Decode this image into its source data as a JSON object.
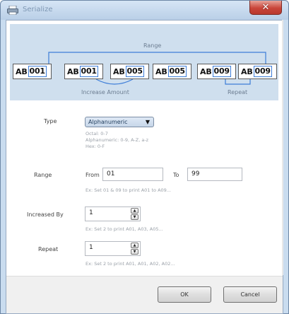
{
  "window": {
    "title": "Serialize",
    "close_icon": "close-icon"
  },
  "illustration": {
    "range_label": "Range",
    "increase_label": "Increase Amount",
    "repeat_label": "Repeat",
    "chips": [
      {
        "prefix": "AB",
        "num": "001"
      },
      {
        "prefix": "AB",
        "num": "001"
      },
      {
        "prefix": "AB",
        "num": "005"
      },
      {
        "prefix": "AB",
        "num": "005"
      },
      {
        "prefix": "AB",
        "num": "009"
      },
      {
        "prefix": "AB",
        "num": "009"
      }
    ]
  },
  "form": {
    "type_label": "Type",
    "type_value": "Alphanumeric",
    "type_hints": [
      "Octal: 0-7",
      "Alphanumeric: 0-9, A-Z, a-z",
      "Hex: 0-F"
    ],
    "range_label": "Range",
    "from_label": "From",
    "from_value": "01",
    "to_label": "To",
    "to_value": "99",
    "range_hint": "Ex: Set 01 & 09 to print A01 to A09...",
    "increased_label": "Increased By",
    "increased_value": "1",
    "increased_hint": "Ex: Set 2 to print A01, A03, A05...",
    "repeat_label": "Repeat",
    "repeat_value": "1",
    "repeat_hint": "Ex: Set 2 to print A01, A01, A02, A02..."
  },
  "buttons": {
    "ok": "OK",
    "cancel": "Cancel"
  },
  "colors": {
    "accent": "#3d7dd8",
    "illustration_bg": "#cfdfee",
    "close": "#c9453a"
  }
}
